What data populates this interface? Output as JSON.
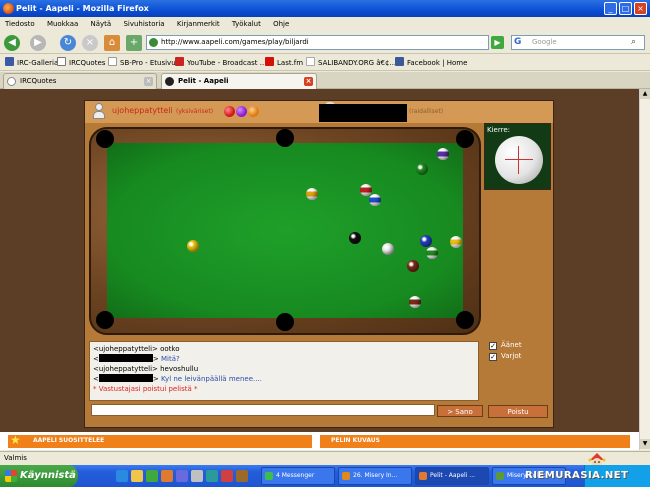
{
  "window": {
    "title": "Pelit - Aapeli - Mozilla Firefox"
  },
  "menu": [
    "Tiedosto",
    "Muokkaa",
    "Näytä",
    "Sivuhistoria",
    "Kirjanmerkit",
    "Työkalut",
    "Ohje"
  ],
  "address": {
    "url": "http://www.aapeli.com/games/play/biljardi",
    "search_placeholder": "Google"
  },
  "bookmarks": [
    {
      "label": "IRC-Galleria",
      "color": "#3a5aa8"
    },
    {
      "label": "IRCQuotes",
      "color": "#777777"
    },
    {
      "label": "SB-Pro - Etusivu",
      "color": "#999999"
    },
    {
      "label": "YouTube - Broadcast ...",
      "color": "#cc2222"
    },
    {
      "label": "Last.fm",
      "color": "#d51007"
    },
    {
      "label": "SALIBANDY.ORG â€¢...",
      "color": "#aaaaaa"
    },
    {
      "label": "Facebook | Home",
      "color": "#3b5998"
    }
  ],
  "tabs": [
    {
      "label": "IRCQuotes",
      "active": false
    },
    {
      "label": "Pelit - Aapeli",
      "active": true
    }
  ],
  "game": {
    "player1": {
      "name": "ujoheppatytteli",
      "type": "(yksiväriset)"
    },
    "player2": {
      "type": "(raidalliset)"
    },
    "spin_label": "Kierre:",
    "chat": [
      {
        "kind": "line",
        "sender": "<ujoheppatytteli>",
        "text": "ootko"
      },
      {
        "kind": "redacted",
        "text": "Mitä?"
      },
      {
        "kind": "line",
        "sender": "<ujoheppatytteli>",
        "text": "hevoshullu"
      },
      {
        "kind": "redacted",
        "text": "Kyl ne leivänpäällä menee...."
      },
      {
        "kind": "system",
        "text": "* Vastustajasi poistui pelistä *"
      }
    ],
    "options": [
      {
        "label": "Äänet",
        "checked": true
      },
      {
        "label": "Varjot",
        "checked": true
      }
    ],
    "send_label": "> Sano",
    "quit_label": "Poistu"
  },
  "footer": {
    "recommends": "AAPELI SUOSITTELEE",
    "description": "PELIN KUVAUS"
  },
  "status": "Valmis",
  "taskbar": {
    "start": "Käynnistä",
    "tasks": [
      {
        "label": "4 Messenger",
        "color": "#3bbf4a"
      },
      {
        "label": "26. Misery In...",
        "color": "#e08a1e"
      },
      {
        "label": "Pelit - Aapeli ...",
        "color": "#e07a2e"
      },
      {
        "label": "Misery Index",
        "color": "#5a9a3a"
      }
    ],
    "watermark": "RIEMURASIA.NET"
  },
  "colors": {
    "felt": "#178a20",
    "panel": "#b57a38",
    "accent": "#f08019"
  }
}
